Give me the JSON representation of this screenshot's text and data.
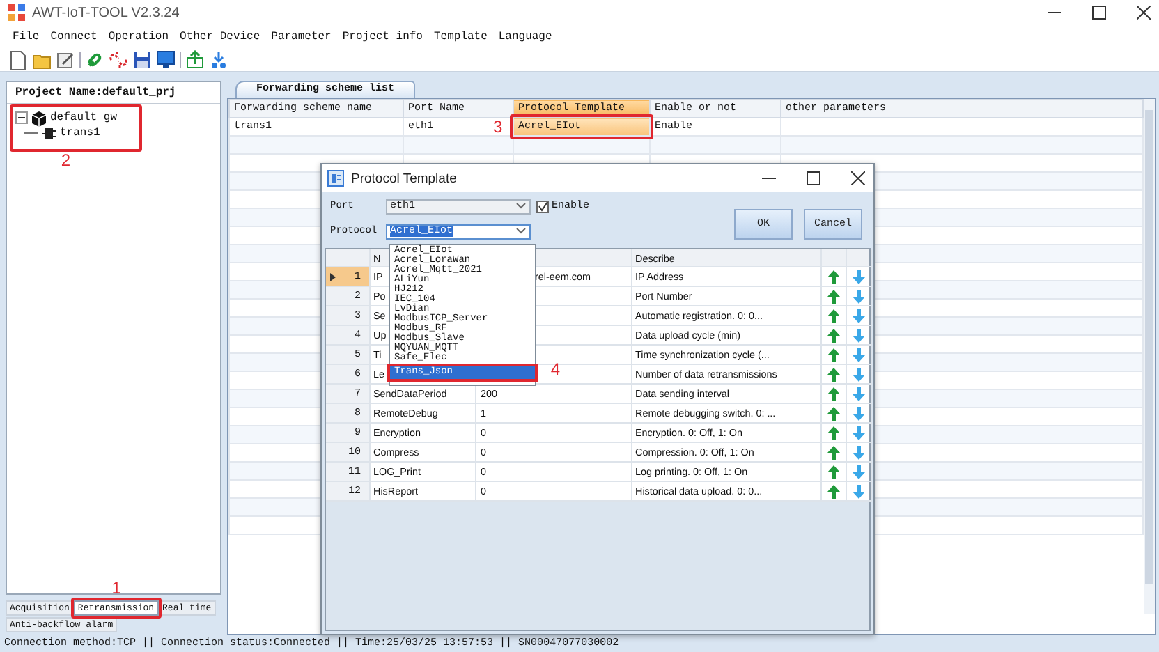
{
  "window": {
    "title": "AWT-IoT-TOOL V2.3.24"
  },
  "menu": [
    "File",
    "Connect",
    "Operation",
    "Other Device",
    "Parameter",
    "Project info",
    "Template",
    "Language"
  ],
  "project_panel": {
    "title": "Project Name:default_prj",
    "tree": [
      {
        "label": "default_gw",
        "kind": "gateway",
        "expanded": true,
        "annotation": {
          "label": "2"
        },
        "children": [
          {
            "label": "trans1",
            "kind": "channel"
          }
        ]
      }
    ]
  },
  "bottom_tabs": [
    {
      "label": "Acquisition",
      "selected": false
    },
    {
      "label": "Retransmission",
      "selected": true,
      "annotation": {
        "label": "1"
      }
    },
    {
      "label": "Real time",
      "selected": false
    },
    {
      "label": "Anti-backflow alarm",
      "selected": false
    }
  ],
  "main_tab": {
    "label": "Forwarding scheme list",
    "selected": true
  },
  "scheme_table": {
    "columns": [
      {
        "label": "Forwarding scheme name",
        "selected": false
      },
      {
        "label": "Port Name",
        "selected": false
      },
      {
        "label": "Protocol Template",
        "selected": true
      },
      {
        "label": "Enable or not",
        "selected": false
      },
      {
        "label": "other parameters",
        "selected": false
      }
    ],
    "rows": [
      {
        "cells": [
          {
            "text": "trans1",
            "selected": false
          },
          {
            "text": "eth1",
            "selected": false
          },
          {
            "text": "Acrel_EIot",
            "selected": true,
            "annotation": {
              "label": "3"
            }
          },
          {
            "text": "Enable",
            "selected": false
          }
        ]
      }
    ]
  },
  "dialog": {
    "title": "Protocol Template",
    "port_label": "Port",
    "port": "eth1",
    "enable_label": "Enable",
    "enabled": true,
    "protocol_label": "Protocol",
    "protocol": "Acrel_EIot",
    "buttons": [
      "OK",
      "Cancel"
    ],
    "grid": {
      "columns": [
        "N",
        "Describe"
      ],
      "rows": [
        {
          "index": "1",
          "name": "IP",
          "value": "rel-eem.com",
          "describe": "IP Address",
          "current": true
        },
        {
          "index": "2",
          "name": "Po",
          "describe": "Port Number",
          "current": false
        },
        {
          "index": "3",
          "name": "Se",
          "describe": "Automatic registration. 0: 0...",
          "current": false
        },
        {
          "index": "4",
          "name": "Up",
          "describe": "Data upload cycle (min)",
          "current": false
        },
        {
          "index": "5",
          "name": "Ti",
          "describe": "Time synchronization cycle (...",
          "current": false
        },
        {
          "index": "6",
          "name": "Le",
          "describe": "Number of data retransmissions",
          "current": false
        },
        {
          "index": "7",
          "name": "SendDataPeriod",
          "value": "200",
          "describe": "Data sending interval",
          "current": false
        },
        {
          "index": "8",
          "name": "RemoteDebug",
          "value": "1",
          "describe": "Remote debugging switch. 0: ...",
          "current": false
        },
        {
          "index": "9",
          "name": "Encryption",
          "value": "0",
          "describe": "Encryption. 0: Off, 1: On",
          "current": false
        },
        {
          "index": "10",
          "name": "Compress",
          "value": "0",
          "describe": "Compression. 0: Off, 1: On",
          "current": false
        },
        {
          "index": "11",
          "name": "LOG_Print",
          "value": "0",
          "describe": "Log printing. 0: Off, 1: On",
          "current": false
        },
        {
          "index": "12",
          "name": "HisReport",
          "value": "0",
          "describe": "Historical data upload. 0: 0...",
          "current": false
        }
      ]
    },
    "dropdown": {
      "items": [
        {
          "label": "Acrel_EIot",
          "selected": false
        },
        {
          "label": "Acrel_LoraWan",
          "selected": false
        },
        {
          "label": "Acrel_Mqtt_2021",
          "selected": false
        },
        {
          "label": "ALiYun",
          "selected": false
        },
        {
          "label": "HJ212",
          "selected": false
        },
        {
          "label": "IEC_104",
          "selected": false
        },
        {
          "label": "LvDian",
          "selected": false
        },
        {
          "label": "ModbusTCP_Server",
          "selected": false
        },
        {
          "label": "Modbus_RF",
          "selected": false
        },
        {
          "label": "Modbus_Slave",
          "selected": false
        },
        {
          "label": "MQYUAN_MQTT",
          "selected": false
        },
        {
          "label": "Safe_Elec",
          "selected": false
        },
        {
          "label": "Trans_Json",
          "selected": true,
          "annotation": {
            "label": "4"
          }
        }
      ]
    }
  },
  "status_bar": "Connection method:TCP || Connection status:Connected || Time:25/03/25 13:57:53 || SN00047077030002"
}
